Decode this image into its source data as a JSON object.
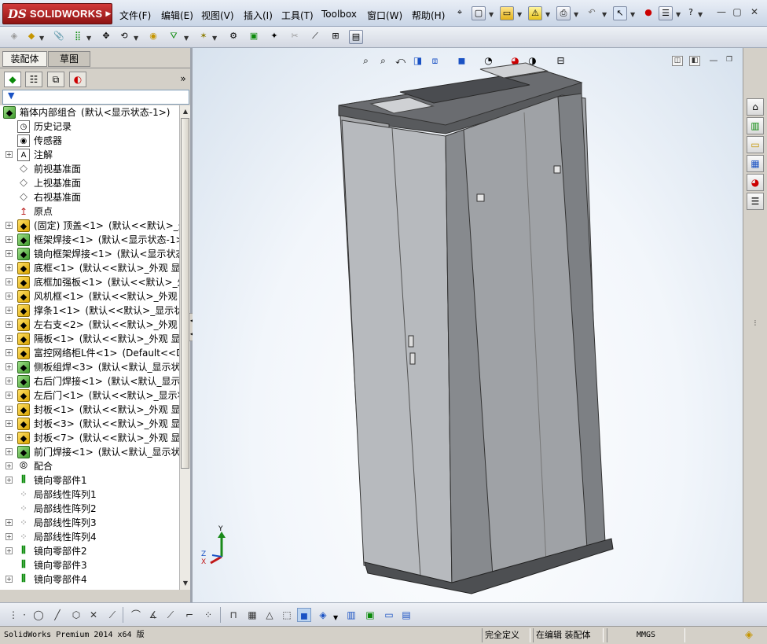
{
  "app": {
    "brand": "SOLIDWORKS",
    "ds_mark": "DS"
  },
  "menu": [
    "文件(F)",
    "编辑(E)",
    "视图(V)",
    "插入(I)",
    "工具(T)",
    "Toolbox",
    "窗口(W)",
    "帮助(H)"
  ],
  "left_panel": {
    "tabs": [
      "装配体",
      "草图"
    ],
    "tree": [
      {
        "label": "箱体内部组合",
        "config": "(默认<显示状态-1>)",
        "icon": "assembly-icon",
        "expander": false,
        "indent": 0
      },
      {
        "label": "历史记录",
        "config": "",
        "icon": "history-icon",
        "expander": false,
        "indent": 1
      },
      {
        "label": "传感器",
        "config": "",
        "icon": "sensor-icon",
        "expander": false,
        "indent": 1
      },
      {
        "label": "注解",
        "config": "",
        "icon": "annotation-icon",
        "expander": true,
        "indent": 1
      },
      {
        "label": "前视基准面",
        "config": "",
        "icon": "plane-icon",
        "expander": false,
        "indent": 1
      },
      {
        "label": "上视基准面",
        "config": "",
        "icon": "plane-icon",
        "expander": false,
        "indent": 1
      },
      {
        "label": "右视基准面",
        "config": "",
        "icon": "plane-icon",
        "expander": false,
        "indent": 1
      },
      {
        "label": "原点",
        "config": "",
        "icon": "origin-icon",
        "expander": false,
        "indent": 1
      },
      {
        "label": "(固定) 顶盖<1>",
        "config": "(默认<<默认>_外观",
        "icon": "part-icon",
        "expander": true,
        "indent": 1
      },
      {
        "label": "框架焊接<1>",
        "config": "(默认<显示状态-1>)",
        "icon": "subassembly-icon",
        "expander": true,
        "indent": 1
      },
      {
        "label": "镜向框架焊接<1>",
        "config": "(默认<显示状态-",
        "icon": "subassembly-icon",
        "expander": true,
        "indent": 1
      },
      {
        "label": "底框<1>",
        "config": "(默认<<默认>_外观 显示",
        "icon": "part-icon",
        "expander": true,
        "indent": 1
      },
      {
        "label": "底框加强板<1>",
        "config": "(默认<<默认>_外观",
        "icon": "part-icon",
        "expander": true,
        "indent": 1
      },
      {
        "label": "风机框<1>",
        "config": "(默认<<默认>_外观 显示",
        "icon": "part-icon",
        "expander": true,
        "indent": 1
      },
      {
        "label": "撑条1<1>",
        "config": "(默认<<默认>_显示状态",
        "icon": "part-icon",
        "expander": true,
        "indent": 1
      },
      {
        "label": "左右支<2>",
        "config": "(默认<<默认>_外观 显示",
        "icon": "part-icon",
        "expander": true,
        "indent": 1
      },
      {
        "label": "隔板<1>",
        "config": "(默认<<默认>_外观 显示",
        "icon": "part-icon",
        "expander": true,
        "indent": 1
      },
      {
        "label": "富控网络柜L件<1>",
        "config": "(Default<<Default",
        "icon": "part-icon",
        "expander": true,
        "indent": 1
      },
      {
        "label": "侧板组焊<3>",
        "config": "(默认<默认_显示状态",
        "icon": "subassembly-icon",
        "expander": true,
        "indent": 1
      },
      {
        "label": "右后门焊接<1>",
        "config": "(默认<默认_显示状",
        "icon": "subassembly-icon",
        "expander": true,
        "indent": 1
      },
      {
        "label": "左后门<1>",
        "config": "(默认<<默认>_显示状态",
        "icon": "part-icon",
        "expander": true,
        "indent": 1
      },
      {
        "label": "封板<1>",
        "config": "(默认<<默认>_外观 显示",
        "icon": "part-icon",
        "expander": true,
        "indent": 1
      },
      {
        "label": "封板<3>",
        "config": "(默认<<默认>_外观 显示",
        "icon": "part-icon",
        "expander": true,
        "indent": 1
      },
      {
        "label": "封板<7>",
        "config": "(默认<<默认>_外观 显示",
        "icon": "part-icon",
        "expander": true,
        "indent": 1
      },
      {
        "label": "前门焊接<1>",
        "config": "(默认<默认_显示状态",
        "icon": "subassembly-icon",
        "expander": true,
        "indent": 1
      },
      {
        "label": "配合",
        "config": "",
        "icon": "mates-icon",
        "expander": true,
        "indent": 1
      },
      {
        "label": "镜向零部件1",
        "config": "",
        "icon": "mirror-icon",
        "expander": true,
        "indent": 1
      },
      {
        "label": "局部线性阵列1",
        "config": "",
        "icon": "pattern-icon",
        "expander": false,
        "indent": 1
      },
      {
        "label": "局部线性阵列2",
        "config": "",
        "icon": "pattern-icon",
        "expander": false,
        "indent": 1
      },
      {
        "label": "局部线性阵列3",
        "config": "",
        "icon": "pattern-icon",
        "expander": true,
        "indent": 1
      },
      {
        "label": "局部线性阵列4",
        "config": "",
        "icon": "pattern-icon",
        "expander": true,
        "indent": 1
      },
      {
        "label": "镜向零部件2",
        "config": "",
        "icon": "mirror-icon",
        "expander": true,
        "indent": 1
      },
      {
        "label": "镜向零部件3",
        "config": "",
        "icon": "mirror-icon",
        "expander": false,
        "indent": 1
      },
      {
        "label": "镜向零部件4",
        "config": "",
        "icon": "mirror-icon",
        "expander": true,
        "indent": 1
      }
    ]
  },
  "triad": {
    "x": "X",
    "y": "Y",
    "z": "Z"
  },
  "status": {
    "product": "SolidWorks Premium 2014 x64 版",
    "definition": "完全定义",
    "mode": "在编辑 装配体",
    "units": "MMGS"
  },
  "colors": {
    "accent_red": "#b31b1b",
    "model_panel": "#b9bcc0",
    "model_dark": "#4d4f52"
  }
}
